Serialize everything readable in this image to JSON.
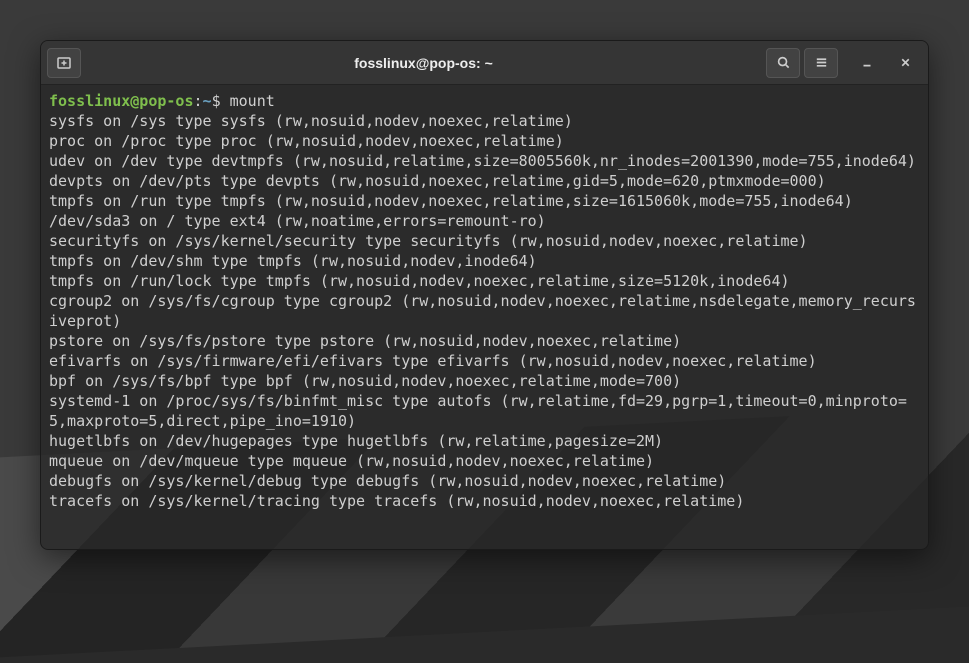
{
  "window": {
    "title": "fosslinux@pop-os: ~"
  },
  "prompt": {
    "user_host": "fosslinux@pop-os",
    "separator": ":",
    "path": "~",
    "symbol": "$",
    "command": "mount"
  },
  "output": [
    "sysfs on /sys type sysfs (rw,nosuid,nodev,noexec,relatime)",
    "proc on /proc type proc (rw,nosuid,nodev,noexec,relatime)",
    "udev on /dev type devtmpfs (rw,nosuid,relatime,size=8005560k,nr_inodes=2001390,mode=755,inode64)",
    "devpts on /dev/pts type devpts (rw,nosuid,noexec,relatime,gid=5,mode=620,ptmxmode=000)",
    "tmpfs on /run type tmpfs (rw,nosuid,nodev,noexec,relatime,size=1615060k,mode=755,inode64)",
    "/dev/sda3 on / type ext4 (rw,noatime,errors=remount-ro)",
    "securityfs on /sys/kernel/security type securityfs (rw,nosuid,nodev,noexec,relatime)",
    "tmpfs on /dev/shm type tmpfs (rw,nosuid,nodev,inode64)",
    "tmpfs on /run/lock type tmpfs (rw,nosuid,nodev,noexec,relatime,size=5120k,inode64)",
    "cgroup2 on /sys/fs/cgroup type cgroup2 (rw,nosuid,nodev,noexec,relatime,nsdelegate,memory_recursiveprot)",
    "pstore on /sys/fs/pstore type pstore (rw,nosuid,nodev,noexec,relatime)",
    "efivarfs on /sys/firmware/efi/efivars type efivarfs (rw,nosuid,nodev,noexec,relatime)",
    "bpf on /sys/fs/bpf type bpf (rw,nosuid,nodev,noexec,relatime,mode=700)",
    "systemd-1 on /proc/sys/fs/binfmt_misc type autofs (rw,relatime,fd=29,pgrp=1,timeout=0,minproto=5,maxproto=5,direct,pipe_ino=1910)",
    "hugetlbfs on /dev/hugepages type hugetlbfs (rw,relatime,pagesize=2M)",
    "mqueue on /dev/mqueue type mqueue (rw,nosuid,nodev,noexec,relatime)",
    "debugfs on /sys/kernel/debug type debugfs (rw,nosuid,nodev,noexec,relatime)",
    "tracefs on /sys/kernel/tracing type tracefs (rw,nosuid,nodev,noexec,relatime)"
  ]
}
